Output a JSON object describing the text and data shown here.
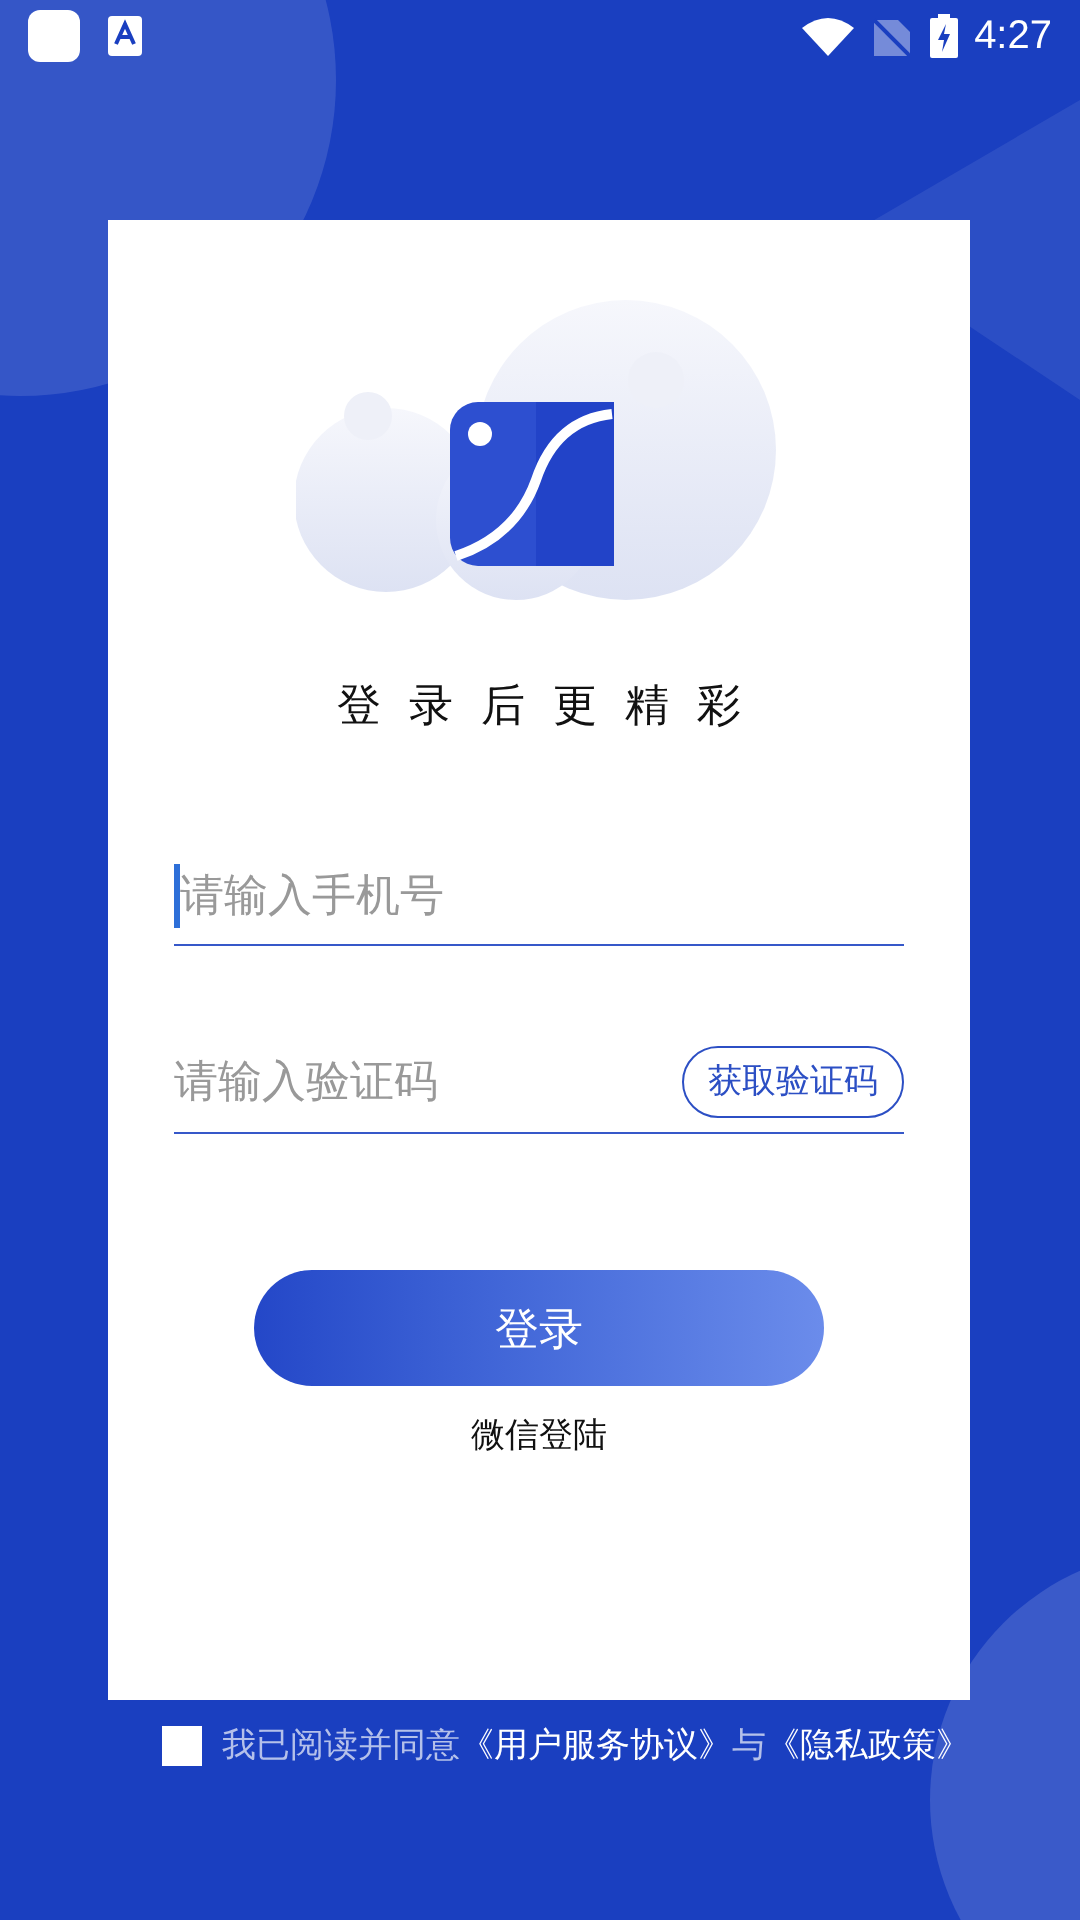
{
  "status_bar": {
    "time": "4:27"
  },
  "title": "登录后更精彩",
  "phone_field": {
    "placeholder": "请输入手机号",
    "focused": true
  },
  "code_field": {
    "placeholder": "请输入验证码"
  },
  "get_code_button": "获取验证码",
  "login_button": "登录",
  "wechat_login": "微信登陆",
  "agreement": {
    "checked": false,
    "parts": [
      {
        "kind": "text",
        "text": "我已阅读并同意"
      },
      {
        "kind": "link",
        "text": "《用户服务协议》"
      },
      {
        "kind": "text",
        "text": "与"
      },
      {
        "kind": "link",
        "text": "《隐私政策》"
      }
    ]
  }
}
